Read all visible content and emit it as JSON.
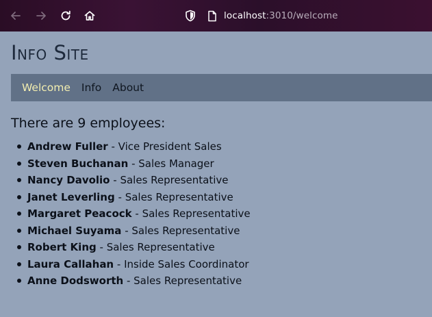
{
  "browser": {
    "url_host": "localhost",
    "url_path": ":3010/welcome"
  },
  "site": {
    "title": "Info Site"
  },
  "nav": {
    "links": [
      {
        "label": "Welcome",
        "active": true
      },
      {
        "label": "Info",
        "active": false
      },
      {
        "label": "About",
        "active": false
      }
    ]
  },
  "main": {
    "heading": "There are 9 employees:",
    "separator": " - ",
    "employees": [
      {
        "name": "Andrew Fuller",
        "title": "Vice President Sales"
      },
      {
        "name": "Steven Buchanan",
        "title": "Sales Manager"
      },
      {
        "name": "Nancy Davolio",
        "title": "Sales Representative"
      },
      {
        "name": "Janet Leverling",
        "title": "Sales Representative"
      },
      {
        "name": "Margaret Peacock",
        "title": "Sales Representative"
      },
      {
        "name": "Michael Suyama",
        "title": "Sales Representative"
      },
      {
        "name": "Robert King",
        "title": "Sales Representative"
      },
      {
        "name": "Laura Callahan",
        "title": "Inside Sales Coordinator"
      },
      {
        "name": "Anne Dodsworth",
        "title": "Sales Representative"
      }
    ]
  },
  "colors": {
    "page_background": "#94a3b9",
    "navbar_background": "#617187",
    "active_link": "#f3eeb0",
    "toolbar_background": "#2a0d25"
  }
}
